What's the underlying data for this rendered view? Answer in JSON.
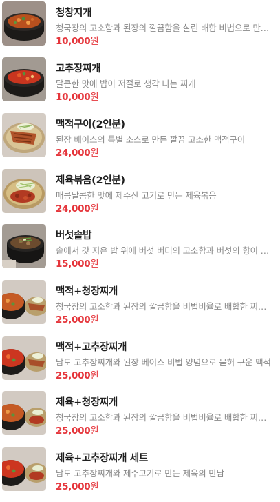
{
  "colors": {
    "price": "#e5353b",
    "name": "#1f1f1f",
    "description": "#8a8a8a",
    "thumb_background": "#cfc6bc"
  },
  "menu": {
    "items": [
      {
        "name": "청창지개",
        "description": "청국장의 고소함과 된장의 깔끔함을 살린 배합 비법으로 만든 찌개",
        "price": "10,000",
        "currency": "원",
        "image": "stew-bowl-image"
      },
      {
        "name": "고추장찌개",
        "description": "달큰한 맛에 밥이 저절로 생각 나는 찌개",
        "price": "10,000",
        "currency": "원",
        "image": "stew-bowl-image"
      },
      {
        "name": "맥적구이(2인분)",
        "description": "된장 베이스의 특별 소스로 만든 깔끔 고소한 맥적구이",
        "price": "24,000",
        "currency": "원",
        "image": "grilled-pork-plate-image"
      },
      {
        "name": "제육볶음(2인분)",
        "description": "매콤달콤한 맛에 제주산 고기로 만든 제육볶음",
        "price": "24,000",
        "currency": "원",
        "image": "spicy-pork-plate-image"
      },
      {
        "name": "버섯솥밥",
        "description": "솥에서 갓 지은 밥 위에 버섯 버터의 고소함과 버섯의 향이 어우러진 솥밥",
        "price": "15,000",
        "currency": "원",
        "image": "mushroom-pot-rice-image"
      },
      {
        "name": "맥적+청장찌개",
        "description": "청국장의 고소함과 된장의 깔끔함을 비법비율로 배합한 찌개와 맥적",
        "price": "25,000",
        "currency": "원",
        "image": "set-meal-image"
      },
      {
        "name": "맥적+고추장찌개",
        "description": "남도 고추장찌개와 된장 베이스 비법 양념으로 묻혀 구운 맥적",
        "price": "25,000",
        "currency": "원",
        "image": "set-meal-image"
      },
      {
        "name": "제육+청장찌개",
        "description": "청국장의 고소함과 된장의 깔끔함을 비법비율로 배합한 찌개와 제육",
        "price": "25,000",
        "currency": "원",
        "image": "set-meal-image"
      },
      {
        "name": "제육+고추장찌개 세트",
        "description": "남도 고추장찌개와 제주고기로 만든 제육의 만남",
        "price": "25,000",
        "currency": "원",
        "image": "set-meal-image"
      }
    ]
  }
}
